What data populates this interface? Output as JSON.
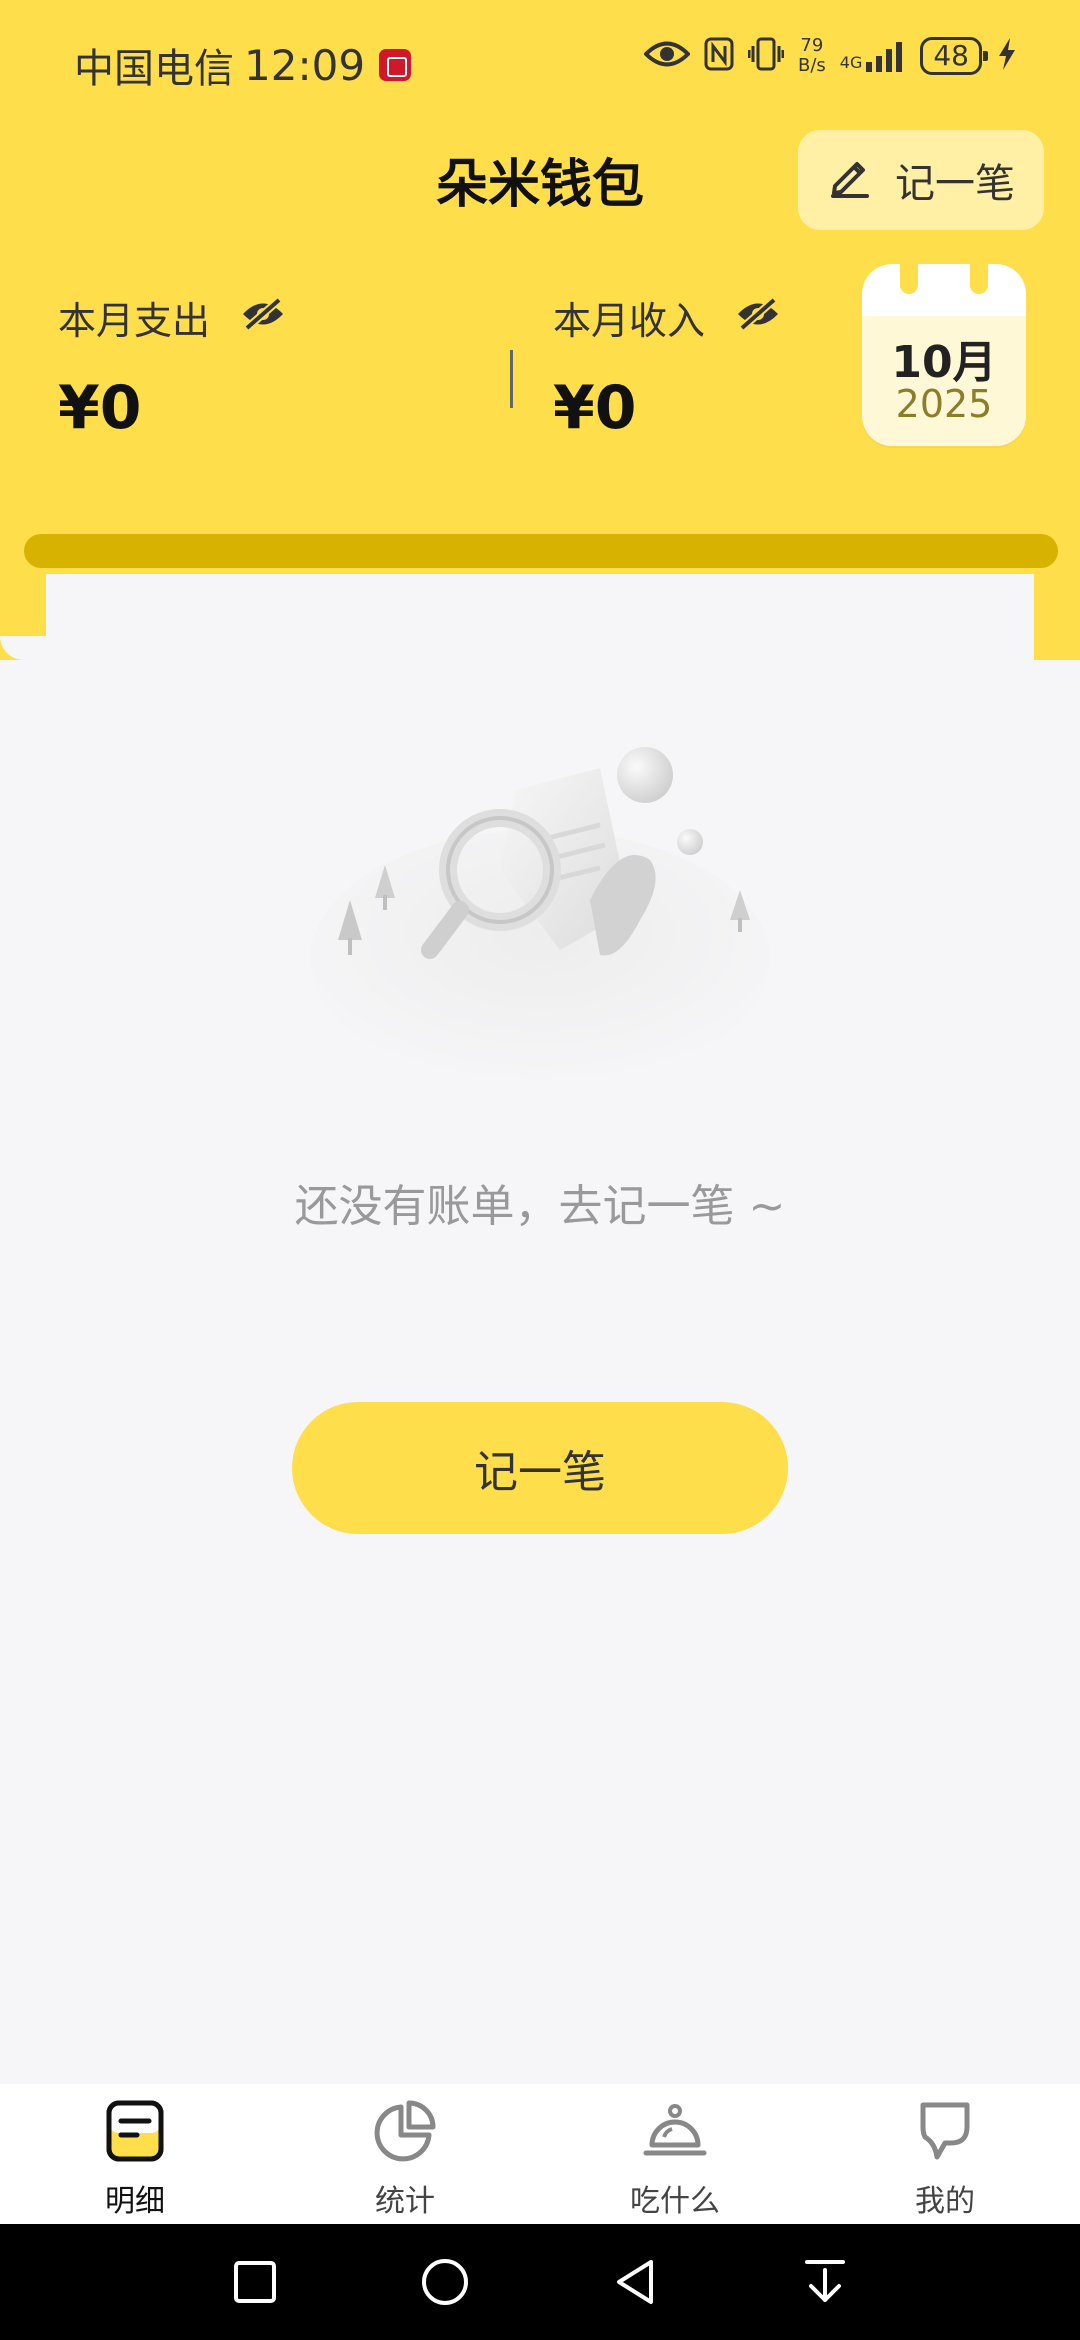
{
  "status_bar": {
    "carrier": "中国电信",
    "time": "12:09",
    "net_speed_value": "79",
    "net_speed_unit": "B/s",
    "network": "4G",
    "battery": "48"
  },
  "header": {
    "title": "朵米钱包",
    "record_button": "记一笔",
    "expense_label": "本月支出",
    "expense_value": "¥0",
    "income_label": "本月收入",
    "income_value": "¥0",
    "calendar_month": "10月",
    "calendar_year": "2025"
  },
  "empty_state": {
    "message": "还没有账单，去记一笔 ~",
    "button": "记一笔"
  },
  "tabs": [
    {
      "label": "明细",
      "icon": "bill-icon",
      "active": true
    },
    {
      "label": "统计",
      "icon": "pie-chart-icon",
      "active": false
    },
    {
      "label": "吃什么",
      "icon": "food-bell-icon",
      "active": false
    },
    {
      "label": "我的",
      "icon": "profile-icon",
      "active": false
    }
  ],
  "colors": {
    "accent": "#FEDE4A",
    "accent_dark": "#D7B300",
    "background": "#F6F6F8"
  }
}
